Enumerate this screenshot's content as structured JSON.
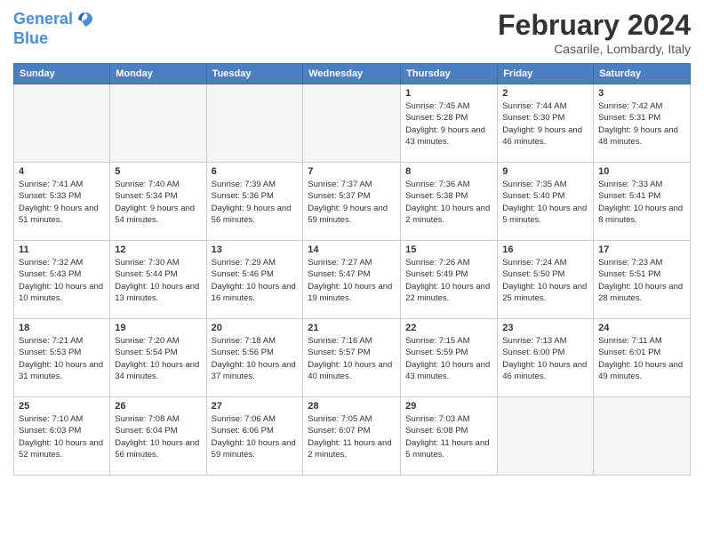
{
  "header": {
    "logo_line1": "General",
    "logo_line2": "Blue",
    "month_year": "February 2024",
    "location": "Casarile, Lombardy, Italy"
  },
  "weekdays": [
    "Sunday",
    "Monday",
    "Tuesday",
    "Wednesday",
    "Thursday",
    "Friday",
    "Saturday"
  ],
  "weeks": [
    [
      {
        "day": "",
        "empty": true
      },
      {
        "day": "",
        "empty": true
      },
      {
        "day": "",
        "empty": true
      },
      {
        "day": "",
        "empty": true
      },
      {
        "day": "1",
        "sunrise": "7:45 AM",
        "sunset": "5:28 PM",
        "daylight": "9 hours and 43 minutes."
      },
      {
        "day": "2",
        "sunrise": "7:44 AM",
        "sunset": "5:30 PM",
        "daylight": "9 hours and 46 minutes."
      },
      {
        "day": "3",
        "sunrise": "7:42 AM",
        "sunset": "5:31 PM",
        "daylight": "9 hours and 48 minutes."
      }
    ],
    [
      {
        "day": "4",
        "sunrise": "7:41 AM",
        "sunset": "5:33 PM",
        "daylight": "9 hours and 51 minutes."
      },
      {
        "day": "5",
        "sunrise": "7:40 AM",
        "sunset": "5:34 PM",
        "daylight": "9 hours and 54 minutes."
      },
      {
        "day": "6",
        "sunrise": "7:39 AM",
        "sunset": "5:36 PM",
        "daylight": "9 hours and 56 minutes."
      },
      {
        "day": "7",
        "sunrise": "7:37 AM",
        "sunset": "5:37 PM",
        "daylight": "9 hours and 59 minutes."
      },
      {
        "day": "8",
        "sunrise": "7:36 AM",
        "sunset": "5:38 PM",
        "daylight": "10 hours and 2 minutes."
      },
      {
        "day": "9",
        "sunrise": "7:35 AM",
        "sunset": "5:40 PM",
        "daylight": "10 hours and 5 minutes."
      },
      {
        "day": "10",
        "sunrise": "7:33 AM",
        "sunset": "5:41 PM",
        "daylight": "10 hours and 8 minutes."
      }
    ],
    [
      {
        "day": "11",
        "sunrise": "7:32 AM",
        "sunset": "5:43 PM",
        "daylight": "10 hours and 10 minutes."
      },
      {
        "day": "12",
        "sunrise": "7:30 AM",
        "sunset": "5:44 PM",
        "daylight": "10 hours and 13 minutes."
      },
      {
        "day": "13",
        "sunrise": "7:29 AM",
        "sunset": "5:46 PM",
        "daylight": "10 hours and 16 minutes."
      },
      {
        "day": "14",
        "sunrise": "7:27 AM",
        "sunset": "5:47 PM",
        "daylight": "10 hours and 19 minutes."
      },
      {
        "day": "15",
        "sunrise": "7:26 AM",
        "sunset": "5:49 PM",
        "daylight": "10 hours and 22 minutes."
      },
      {
        "day": "16",
        "sunrise": "7:24 AM",
        "sunset": "5:50 PM",
        "daylight": "10 hours and 25 minutes."
      },
      {
        "day": "17",
        "sunrise": "7:23 AM",
        "sunset": "5:51 PM",
        "daylight": "10 hours and 28 minutes."
      }
    ],
    [
      {
        "day": "18",
        "sunrise": "7:21 AM",
        "sunset": "5:53 PM",
        "daylight": "10 hours and 31 minutes."
      },
      {
        "day": "19",
        "sunrise": "7:20 AM",
        "sunset": "5:54 PM",
        "daylight": "10 hours and 34 minutes."
      },
      {
        "day": "20",
        "sunrise": "7:18 AM",
        "sunset": "5:56 PM",
        "daylight": "10 hours and 37 minutes."
      },
      {
        "day": "21",
        "sunrise": "7:16 AM",
        "sunset": "5:57 PM",
        "daylight": "10 hours and 40 minutes."
      },
      {
        "day": "22",
        "sunrise": "7:15 AM",
        "sunset": "5:59 PM",
        "daylight": "10 hours and 43 minutes."
      },
      {
        "day": "23",
        "sunrise": "7:13 AM",
        "sunset": "6:00 PM",
        "daylight": "10 hours and 46 minutes."
      },
      {
        "day": "24",
        "sunrise": "7:11 AM",
        "sunset": "6:01 PM",
        "daylight": "10 hours and 49 minutes."
      }
    ],
    [
      {
        "day": "25",
        "sunrise": "7:10 AM",
        "sunset": "6:03 PM",
        "daylight": "10 hours and 52 minutes."
      },
      {
        "day": "26",
        "sunrise": "7:08 AM",
        "sunset": "6:04 PM",
        "daylight": "10 hours and 56 minutes."
      },
      {
        "day": "27",
        "sunrise": "7:06 AM",
        "sunset": "6:06 PM",
        "daylight": "10 hours and 59 minutes."
      },
      {
        "day": "28",
        "sunrise": "7:05 AM",
        "sunset": "6:07 PM",
        "daylight": "11 hours and 2 minutes."
      },
      {
        "day": "29",
        "sunrise": "7:03 AM",
        "sunset": "6:08 PM",
        "daylight": "11 hours and 5 minutes."
      },
      {
        "day": "",
        "empty": true
      },
      {
        "day": "",
        "empty": true
      }
    ]
  ]
}
